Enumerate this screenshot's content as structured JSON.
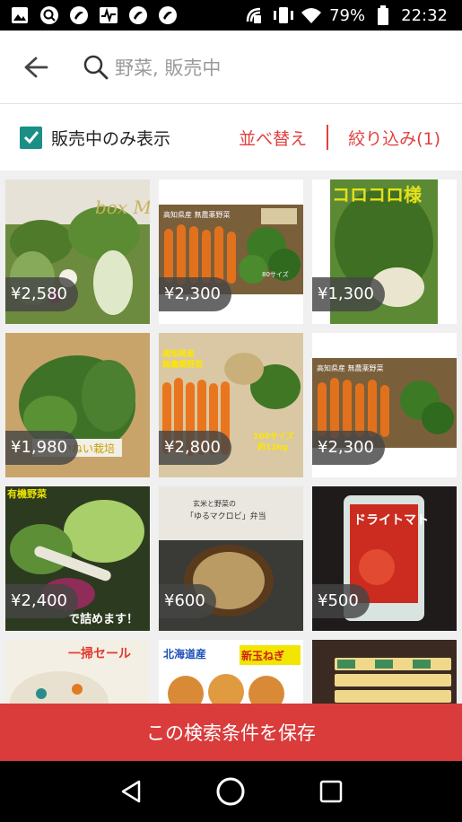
{
  "status_bar": {
    "battery": "79%",
    "time": "22:32",
    "icons": [
      "gallery-icon",
      "search-app-icon",
      "app-circle-icon",
      "activity-icon",
      "app-circle-icon",
      "app-circle-icon",
      "nfc-icon",
      "vibrate-icon",
      "wifi-icon",
      "battery-icon"
    ]
  },
  "header": {
    "back_icon": "arrow-left-icon",
    "search_icon": "search-icon",
    "search_placeholder": "野菜, 販売中"
  },
  "filters": {
    "on_sale_only_label": "販売中のみ表示",
    "on_sale_only_checked": true,
    "sort_label": "並べ替え",
    "filter_label": "絞り込み(1)"
  },
  "colors": {
    "accent_red": "#da3b3b",
    "check_teal": "#1a8f86",
    "link_red": "#e0413f"
  },
  "products": [
    {
      "price": "¥2,580",
      "overlay_text": "box M"
    },
    {
      "price": "¥2,300",
      "overlay_text": "高知県産 無農薬野菜 3点セット 80サイズ 約7kg"
    },
    {
      "price": "¥1,300",
      "overlay_text": "コロコロ様"
    },
    {
      "price": "¥1,980",
      "overlay_text": "いねい栽培"
    },
    {
      "price": "¥2,800",
      "overlay_text": "高知県産 無農薬野菜 4点セット 100サイズ 約12kg"
    },
    {
      "price": "¥2,300",
      "overlay_text": "高知県産 無農薬野菜 3点セット 80サイズ 約7kg"
    },
    {
      "price": "¥2,400",
      "overlay_text": "有機野菜 で詰めます！"
    },
    {
      "price": "¥600",
      "overlay_text": "玄米と野菜の「ゆるマクロビ」弁当"
    },
    {
      "price": "¥500",
      "overlay_text": "ドライトマト"
    },
    {
      "price": "",
      "overlay_text": "一掃セール"
    },
    {
      "price": "",
      "overlay_text": "北海道産 新玉ねぎ"
    },
    {
      "price": "",
      "overlay_text": ""
    }
  ],
  "save_button_label": "この検索条件を保存",
  "nav": {
    "back": "nav-back-icon",
    "home": "nav-home-icon",
    "recents": "nav-recents-icon"
  }
}
